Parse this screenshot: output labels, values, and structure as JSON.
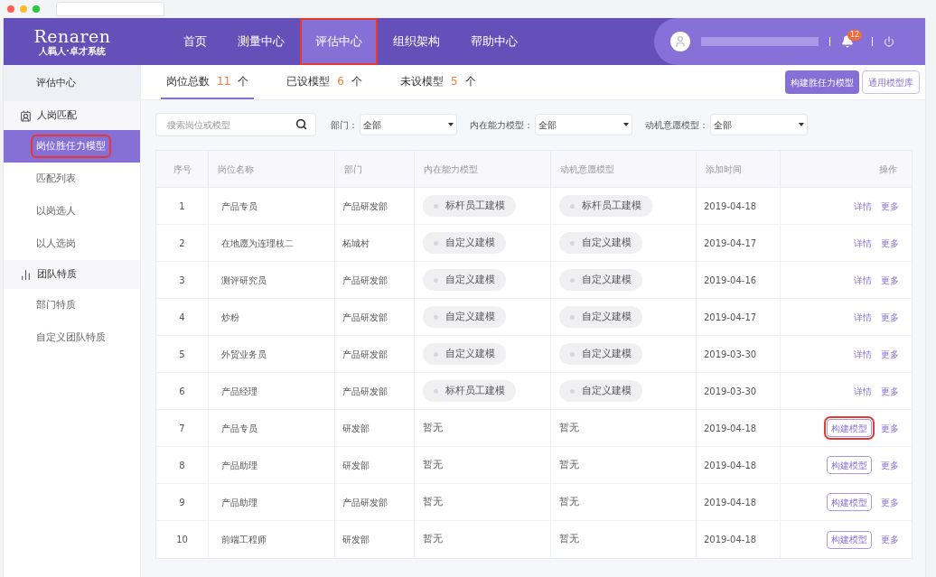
{
  "logo": {
    "title": "Renaren",
    "subtitle": "人羁人·卓才系统"
  },
  "nav": [
    {
      "label": "首页",
      "selected": false,
      "highlighted": false
    },
    {
      "label": "测量中心",
      "selected": false,
      "highlighted": false
    },
    {
      "label": "评估中心",
      "selected": true,
      "highlighted": true
    },
    {
      "label": "组织架构",
      "selected": false,
      "highlighted": false
    },
    {
      "label": "帮助中心",
      "selected": false,
      "highlighted": false
    }
  ],
  "user": {
    "notifications": "12"
  },
  "sidebar": {
    "title": "评估中心",
    "groups": [
      {
        "label": "人岗匹配",
        "kind": "badge",
        "items": [
          {
            "label": "岗位胜任力模型",
            "selected": true,
            "highlighted": true
          },
          {
            "label": "匹配列表",
            "selected": false,
            "highlighted": false
          },
          {
            "label": "以岗选人",
            "selected": false,
            "highlighted": false
          },
          {
            "label": "以人选岗",
            "selected": false,
            "highlighted": false
          }
        ]
      },
      {
        "label": "团队特质",
        "kind": "team",
        "items": [
          {
            "label": "部门特质",
            "selected": false,
            "highlighted": false
          },
          {
            "label": "自定义团队特质",
            "selected": false,
            "highlighted": false
          }
        ]
      }
    ]
  },
  "tabs": [
    {
      "label": "岗位总数",
      "count": "11",
      "unit": "个",
      "selected": true
    },
    {
      "label": "已设模型",
      "count": "6",
      "unit": "个",
      "selected": false
    },
    {
      "label": "未设模型",
      "count": "5",
      "unit": "个",
      "selected": false
    }
  ],
  "toolbar_buttons": [
    {
      "label": "构建胜任力模型",
      "kind": "primary"
    },
    {
      "label": "通用模型库",
      "kind": "outline"
    }
  ],
  "search": {
    "placeholder": "搜索岗位或模型"
  },
  "filters": [
    {
      "label": "部门：",
      "value": "全部"
    },
    {
      "label": "内在能力模型：",
      "value": "全部"
    },
    {
      "label": "动机意愿模型：",
      "value": "全部"
    }
  ],
  "table": {
    "columns": [
      "序号",
      "岗位名称",
      "部门",
      "内在能力模型",
      "动机意愿模型",
      "添加时间",
      "操作"
    ],
    "rows": [
      {
        "no": "1",
        "name": "产品专员",
        "dept": "产品研发部",
        "ability": {
          "kind": "tag",
          "text": "标杆员工建模"
        },
        "motive": {
          "kind": "tag",
          "text": "标杆员工建模"
        },
        "date": "2019-04-18",
        "actions": [
          {
            "kind": "link",
            "label": "详情",
            "highlighted": false
          },
          {
            "kind": "link",
            "label": "更多",
            "highlighted": false
          }
        ]
      },
      {
        "no": "2",
        "name": "在地愿为连理枝二",
        "dept": "柘城村",
        "ability": {
          "kind": "tag",
          "text": "自定义建模"
        },
        "motive": {
          "kind": "tag",
          "text": "自定义建模"
        },
        "date": "2019-04-17",
        "actions": [
          {
            "kind": "link",
            "label": "详情",
            "highlighted": false
          },
          {
            "kind": "link",
            "label": "更多",
            "highlighted": false
          }
        ]
      },
      {
        "no": "3",
        "name": "测评研究员",
        "dept": "产品研发部",
        "ability": {
          "kind": "tag",
          "text": "自定义建模"
        },
        "motive": {
          "kind": "tag",
          "text": "自定义建模"
        },
        "date": "2019-04-16",
        "actions": [
          {
            "kind": "link",
            "label": "详情",
            "highlighted": false
          },
          {
            "kind": "link",
            "label": "更多",
            "highlighted": false
          }
        ]
      },
      {
        "no": "4",
        "name": "炒粉",
        "dept": "产品研发部",
        "ability": {
          "kind": "tag",
          "text": "自定义建模"
        },
        "motive": {
          "kind": "tag",
          "text": "自定义建模"
        },
        "date": "2019-04-17",
        "actions": [
          {
            "kind": "link",
            "label": "详情",
            "highlighted": false
          },
          {
            "kind": "link",
            "label": "更多",
            "highlighted": false
          }
        ]
      },
      {
        "no": "5",
        "name": "外贸业务员",
        "dept": "产品研发部",
        "ability": {
          "kind": "tag",
          "text": "自定义建模"
        },
        "motive": {
          "kind": "tag",
          "text": "自定义建模"
        },
        "date": "2019-03-30",
        "actions": [
          {
            "kind": "link",
            "label": "详情",
            "highlighted": false
          },
          {
            "kind": "link",
            "label": "更多",
            "highlighted": false
          }
        ]
      },
      {
        "no": "6",
        "name": "产品经理",
        "dept": "产品研发部",
        "ability": {
          "kind": "tag",
          "text": "标杆员工建模"
        },
        "motive": {
          "kind": "tag",
          "text": "自定义建模"
        },
        "date": "2019-03-30",
        "actions": [
          {
            "kind": "link",
            "label": "详情",
            "highlighted": false
          },
          {
            "kind": "link",
            "label": "更多",
            "highlighted": false
          }
        ]
      },
      {
        "no": "7",
        "name": "产品专员",
        "dept": "研发部",
        "ability": {
          "kind": "text",
          "text": "暂无"
        },
        "motive": {
          "kind": "text",
          "text": "暂无"
        },
        "date": "2019-04-18",
        "actions": [
          {
            "kind": "button",
            "label": "构建模型",
            "highlighted": true
          },
          {
            "kind": "link",
            "label": "更多",
            "highlighted": false
          }
        ]
      },
      {
        "no": "8",
        "name": "产品助理",
        "dept": "研发部",
        "ability": {
          "kind": "text",
          "text": "暂无"
        },
        "motive": {
          "kind": "text",
          "text": "暂无"
        },
        "date": "2019-04-18",
        "actions": [
          {
            "kind": "button",
            "label": "构建模型",
            "highlighted": false
          },
          {
            "kind": "link",
            "label": "更多",
            "highlighted": false
          }
        ]
      },
      {
        "no": "9",
        "name": "产品助理",
        "dept": "产品研发部",
        "ability": {
          "kind": "text",
          "text": "暂无"
        },
        "motive": {
          "kind": "text",
          "text": "暂无"
        },
        "date": "2019-04-18",
        "actions": [
          {
            "kind": "button",
            "label": "构建模型",
            "highlighted": false
          },
          {
            "kind": "link",
            "label": "更多",
            "highlighted": false
          }
        ]
      },
      {
        "no": "10",
        "name": "前端工程师",
        "dept": "研发部",
        "ability": {
          "kind": "text",
          "text": "暂无"
        },
        "motive": {
          "kind": "text",
          "text": "暂无"
        },
        "date": "2019-04-18",
        "actions": [
          {
            "kind": "button",
            "label": "构建模型",
            "highlighted": false
          },
          {
            "kind": "link",
            "label": "更多",
            "highlighted": false
          }
        ]
      }
    ]
  }
}
